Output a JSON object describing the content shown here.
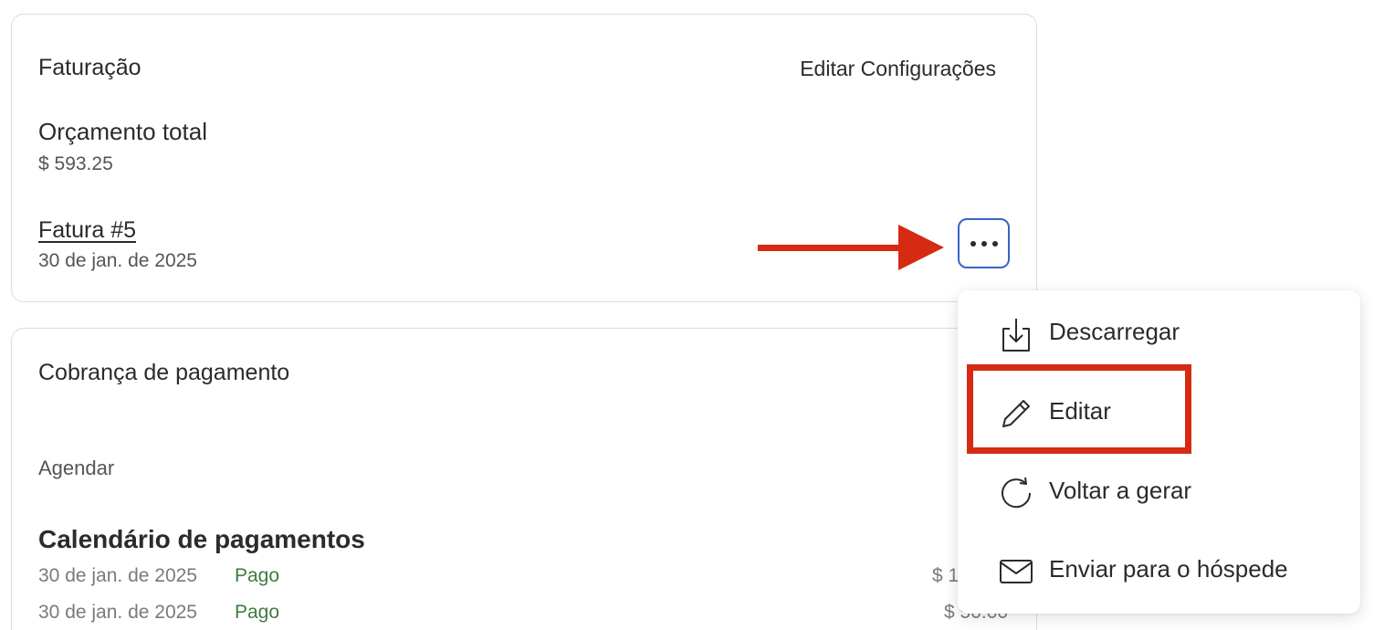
{
  "billing": {
    "title": "Faturação",
    "edit_settings": "Editar Configurações",
    "total_budget_label": "Orçamento total",
    "total_budget_value": "$ 593.25",
    "invoice_link": "Fatura #5",
    "invoice_date": "30 de jan. de 2025",
    "more_icon": "more-horizontal-icon"
  },
  "payment": {
    "title": "Cobrança de pagamento",
    "schedule_label": "Agendar",
    "calendar_heading": "Calendário de pagamentos",
    "rows": [
      {
        "date": "30 de jan. de 2025",
        "status": "Pago",
        "amount": "$ 1"
      },
      {
        "date": "30 de jan. de 2025",
        "status": "Pago",
        "amount": "$ 50.00"
      }
    ]
  },
  "menu": {
    "items": [
      {
        "label": "Descarregar",
        "icon": "download-icon"
      },
      {
        "label": "Editar",
        "icon": "pencil-icon"
      },
      {
        "label": "Voltar a gerar",
        "icon": "refresh-icon"
      },
      {
        "label": "Enviar para o hóspede",
        "icon": "mail-icon"
      }
    ]
  },
  "colors": {
    "annotation_red": "#d62a13",
    "focus_blue": "#3a63c9",
    "paid_green": "#3f7a3f",
    "text_dark": "#2b2b2b"
  }
}
